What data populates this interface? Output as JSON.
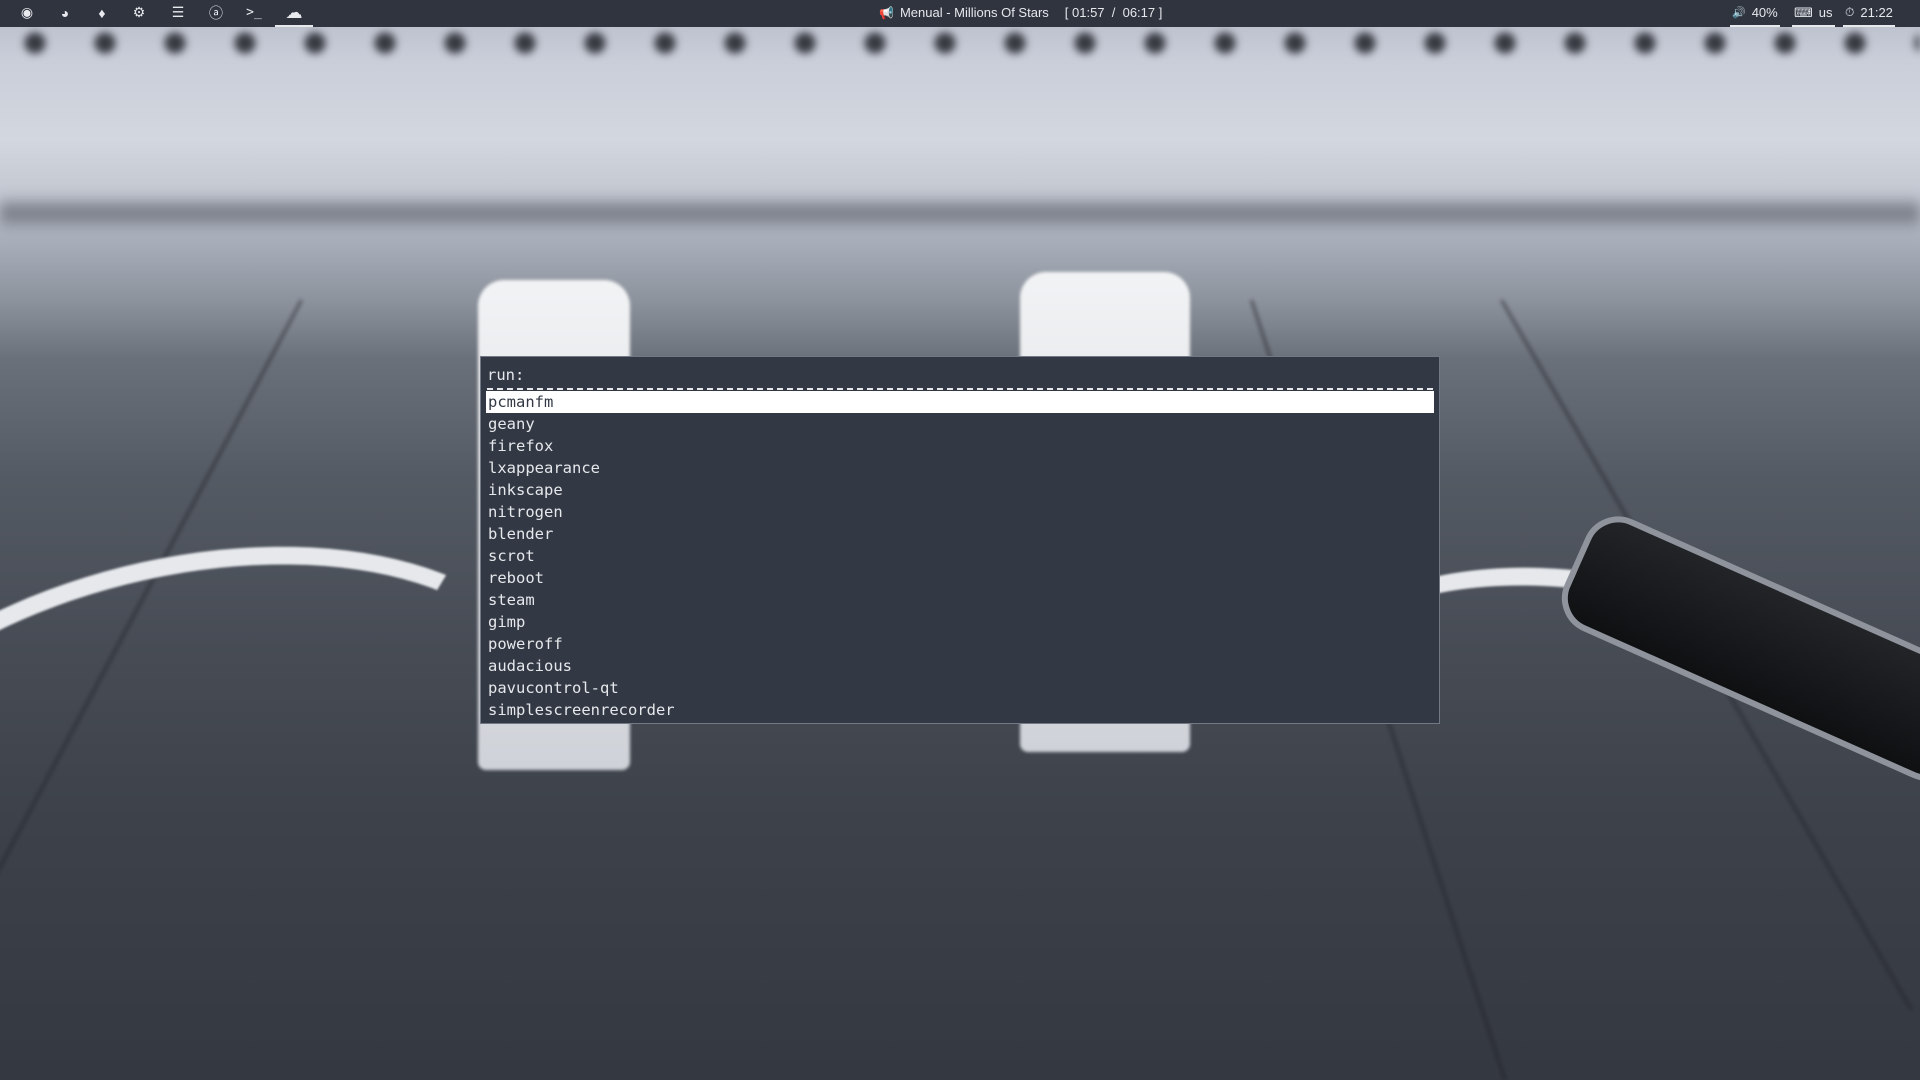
{
  "topbar": {
    "left_icons": [
      {
        "name": "launcher-icon",
        "glyph": "◉"
      },
      {
        "name": "browser-icon",
        "glyph": "◕"
      },
      {
        "name": "flame-icon",
        "glyph": "♦"
      },
      {
        "name": "settings-icon",
        "glyph": "⚙"
      },
      {
        "name": "list-icon",
        "glyph": "☰"
      },
      {
        "name": "circle-a-icon",
        "glyph": "ⓐ"
      },
      {
        "name": "terminal-icon",
        "glyph": ">_"
      },
      {
        "name": "cloud-icon",
        "glyph": "☁"
      }
    ],
    "active_icon": "cloud-icon",
    "now_playing": {
      "icon": "megaphone-icon",
      "glyph": "📢",
      "track": "Menual - Millions Of Stars",
      "time": "[ 01:57  /  06:17 ]"
    },
    "volume": {
      "icon": "speaker-icon",
      "glyph": "🔊",
      "value": "40%"
    },
    "keyboard": {
      "icon": "keyboard-icon",
      "glyph": "⌨",
      "layout": "us"
    },
    "clock": {
      "icon": "clock-icon",
      "glyph": "⏱",
      "time": "21:22"
    }
  },
  "launcher": {
    "prompt": "run:",
    "input_value": "",
    "selected_index": 0,
    "items": [
      "pcmanfm",
      "geany",
      "firefox",
      "lxappearance",
      "inkscape",
      "nitrogen",
      "blender",
      "scrot",
      "reboot",
      "steam",
      "gimp",
      "poweroff",
      "audacious",
      "pavucontrol-qt",
      "simplescreenrecorder"
    ]
  },
  "colors": {
    "bar_bg": "#2f343f",
    "launcher_bg": "#323844",
    "text": "#e6e8ec",
    "selection_bg": "#ffffff"
  }
}
